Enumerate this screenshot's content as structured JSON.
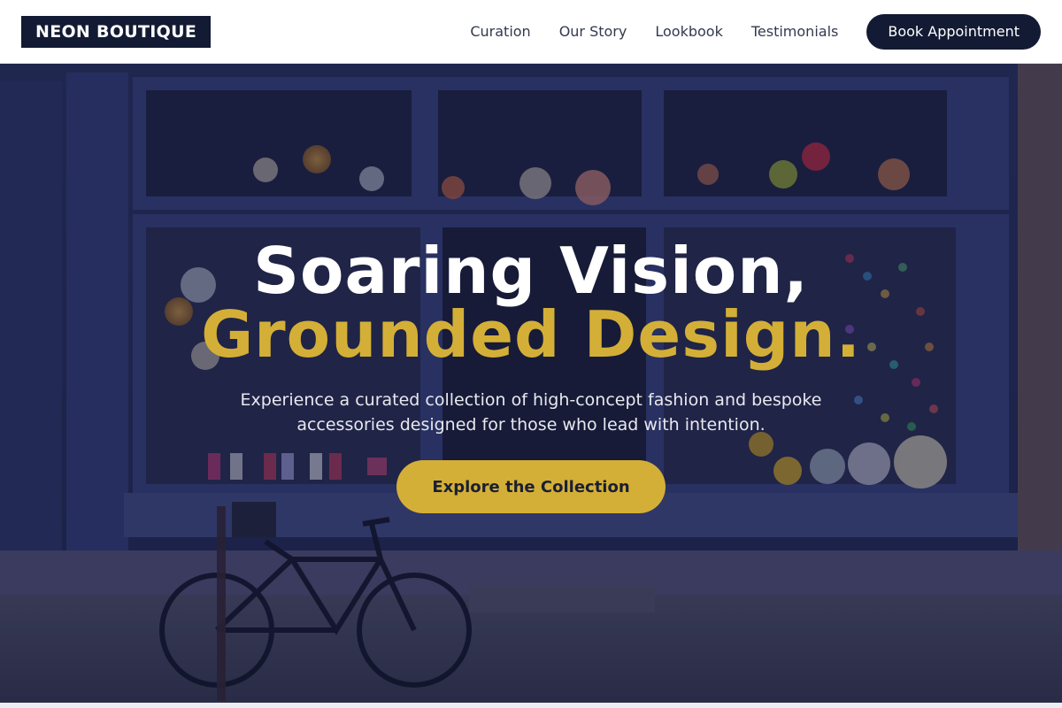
{
  "header": {
    "logo": "NEON BOUTIQUE",
    "nav": [
      "Curation",
      "Our Story",
      "Lookbook",
      "Testimonials"
    ],
    "cta": "Book Appointment"
  },
  "hero": {
    "headline_line1": "Soaring Vision,",
    "headline_line2": "Grounded Design.",
    "subtext": "Experience a curated collection of high-concept fashion and bespoke accessories designed for those who lead with intention.",
    "button": "Explore the Collection"
  },
  "colors": {
    "brand_dark": "#131a33",
    "accent_gold": "#d4af37",
    "header_bg": "#ffffff"
  }
}
